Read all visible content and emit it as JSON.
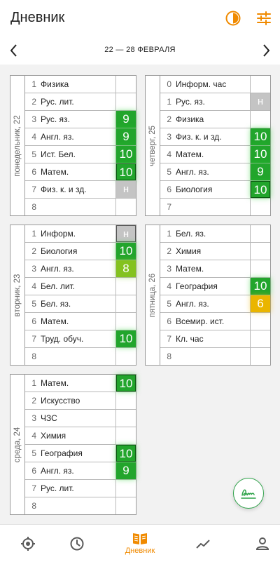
{
  "app": {
    "title": "Дневник"
  },
  "week": {
    "range": "22 — 28 ФЕВРАЛЯ"
  },
  "colors": {
    "accent": "#f08a00",
    "grade_green": "#22a52c",
    "grade_lime": "#84c21e",
    "grade_yellow": "#eab500",
    "absent_gray": "#c4c4c4"
  },
  "days": [
    {
      "label": "понедельник, 22",
      "lessons": [
        {
          "num": "1",
          "subject": "Физика",
          "grade": ""
        },
        {
          "num": "2",
          "subject": "Рус. лит.",
          "grade": ""
        },
        {
          "num": "3",
          "subject": "Рус. яз.",
          "grade": "9",
          "color": "green"
        },
        {
          "num": "4",
          "subject": "Англ. яз.",
          "grade": "9",
          "color": "green"
        },
        {
          "num": "5",
          "subject": "Ист. Бел.",
          "grade": "10",
          "color": "green"
        },
        {
          "num": "6",
          "subject": "Матем.",
          "grade": "10",
          "color": "green",
          "outlined": true
        },
        {
          "num": "7",
          "subject": "Физ. к. и зд.",
          "grade": "н",
          "color": "gray"
        },
        {
          "num": "8",
          "subject": "",
          "grade": ""
        }
      ]
    },
    {
      "label": "четверг, 25",
      "lessons": [
        {
          "num": "0",
          "subject": "Информ. час",
          "grade": ""
        },
        {
          "num": "1",
          "subject": "Рус. яз.",
          "grade": "н",
          "color": "gray"
        },
        {
          "num": "2",
          "subject": "Физика",
          "grade": ""
        },
        {
          "num": "3",
          "subject": "Физ. к. и зд.",
          "grade": "10",
          "color": "green"
        },
        {
          "num": "4",
          "subject": "Матем.",
          "grade": "10",
          "color": "green"
        },
        {
          "num": "5",
          "subject": "Англ. яз.",
          "grade": "9",
          "color": "green"
        },
        {
          "num": "6",
          "subject": "Биология",
          "grade": "10",
          "color": "green",
          "outlined": true
        },
        {
          "num": "7",
          "subject": "",
          "grade": ""
        }
      ]
    },
    {
      "label": "вторник, 23",
      "lessons": [
        {
          "num": "1",
          "subject": "Информ.",
          "grade": "н",
          "color": "gray",
          "outlined": true
        },
        {
          "num": "2",
          "subject": "Биология",
          "grade": "10",
          "color": "green"
        },
        {
          "num": "3",
          "subject": "Англ. яз.",
          "grade": "8",
          "color": "lime"
        },
        {
          "num": "4",
          "subject": "Бел. лит.",
          "grade": ""
        },
        {
          "num": "5",
          "subject": "Бел. яз.",
          "grade": ""
        },
        {
          "num": "6",
          "subject": "Матем.",
          "grade": ""
        },
        {
          "num": "7",
          "subject": "Труд. обуч.",
          "grade": "10",
          "color": "green"
        },
        {
          "num": "8",
          "subject": "",
          "grade": ""
        }
      ]
    },
    {
      "label": "пятница, 26",
      "lessons": [
        {
          "num": "1",
          "subject": "Бел. яз.",
          "grade": ""
        },
        {
          "num": "2",
          "subject": "Химия",
          "grade": ""
        },
        {
          "num": "3",
          "subject": "Матем.",
          "grade": ""
        },
        {
          "num": "4",
          "subject": "География",
          "grade": "10",
          "color": "green"
        },
        {
          "num": "5",
          "subject": "Англ. яз.",
          "grade": "6",
          "color": "yellow"
        },
        {
          "num": "6",
          "subject": "Всемир. ист.",
          "grade": ""
        },
        {
          "num": "7",
          "subject": "Кл. час",
          "grade": ""
        },
        {
          "num": "8",
          "subject": "",
          "grade": ""
        }
      ]
    },
    {
      "label": "среда, 24",
      "lessons": [
        {
          "num": "1",
          "subject": "Матем.",
          "grade": "10",
          "color": "green",
          "outlined": true
        },
        {
          "num": "2",
          "subject": "Искусство",
          "grade": ""
        },
        {
          "num": "3",
          "subject": "ЧЗС",
          "grade": ""
        },
        {
          "num": "4",
          "subject": "Химия",
          "grade": ""
        },
        {
          "num": "5",
          "subject": "География",
          "grade": "10",
          "color": "green",
          "outlined": true
        },
        {
          "num": "6",
          "subject": "Англ. яз.",
          "grade": "9",
          "color": "green"
        },
        {
          "num": "7",
          "subject": "Рус. лит.",
          "grade": ""
        },
        {
          "num": "8",
          "subject": "",
          "grade": ""
        }
      ]
    }
  ],
  "nav": [
    {
      "icon": "target-icon",
      "label": ""
    },
    {
      "icon": "clock-icon",
      "label": ""
    },
    {
      "icon": "diary-book-icon",
      "label": "Дневник",
      "active": true
    },
    {
      "icon": "trend-chart-icon",
      "label": ""
    },
    {
      "icon": "profile-icon",
      "label": ""
    }
  ]
}
